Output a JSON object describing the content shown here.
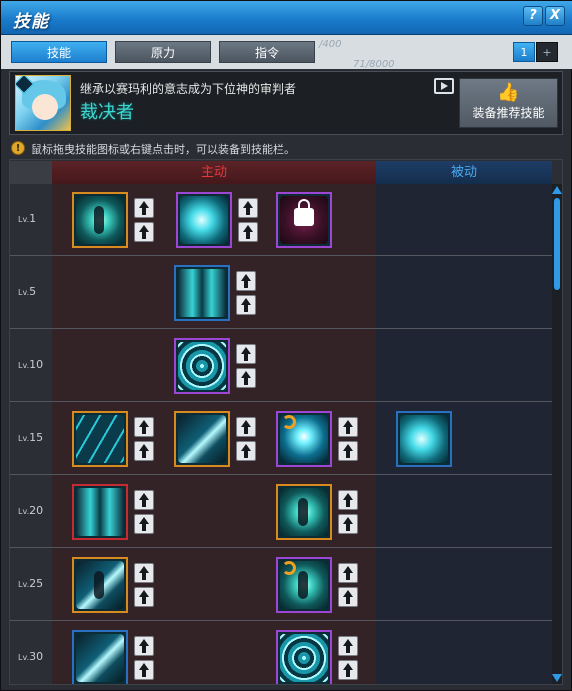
{
  "window": {
    "title": "技能",
    "help_label": "?",
    "close_label": "X"
  },
  "tabs": [
    {
      "label": "技能",
      "active": true
    },
    {
      "label": "原力",
      "active": false
    },
    {
      "label": "指令",
      "active": false
    }
  ],
  "background_counters": {
    "a": "/400",
    "b": "71/8000"
  },
  "pagination": {
    "page": "1",
    "next": "+"
  },
  "header": {
    "description": "继承以赛玛利的意志成为下位神的审判者",
    "job_name": "裁决者",
    "recommend_button": "装备推荐技能"
  },
  "hint": {
    "icon_text": "!",
    "text": "鼠标拖曳技能图标或右键点击时，可以装备到技能栏。"
  },
  "columns": {
    "active": "主动",
    "passive": "被动"
  },
  "rows": [
    {
      "level_prefix": "Lv.",
      "level": "1"
    },
    {
      "level_prefix": "Lv.",
      "level": "5"
    },
    {
      "level_prefix": "Lv.",
      "level": "10"
    },
    {
      "level_prefix": "Lv.",
      "level": "15"
    },
    {
      "level_prefix": "Lv.",
      "level": "20"
    },
    {
      "level_prefix": "Lv.",
      "level": "25"
    },
    {
      "level_prefix": "Lv.",
      "level": "30"
    }
  ],
  "colors": {
    "accent": "#1d7fcf",
    "active_header": "#e0383d",
    "passive_header": "#4aa9f0",
    "job_name": "#3fd6d0"
  }
}
